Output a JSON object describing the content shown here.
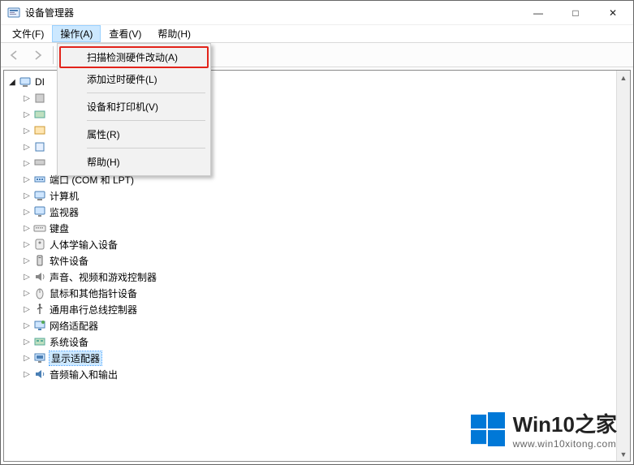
{
  "window": {
    "title": "设备管理器"
  },
  "menubar": {
    "items": [
      {
        "label": "文件(F)"
      },
      {
        "label": "操作(A)",
        "active": true
      },
      {
        "label": "查看(V)"
      },
      {
        "label": "帮助(H)"
      }
    ]
  },
  "dropdown": {
    "items": [
      {
        "label": "扫描检测硬件改动(A)",
        "highlight": true
      },
      {
        "label": "添加过时硬件(L)"
      },
      {
        "sep": true
      },
      {
        "label": "设备和打印机(V)"
      },
      {
        "sep": true
      },
      {
        "label": "属性(R)"
      },
      {
        "sep": true
      },
      {
        "label": "帮助(H)"
      }
    ]
  },
  "tree": {
    "root": {
      "label": "DI",
      "icon": "computer-icon",
      "expanded": true
    },
    "children": [
      {
        "label": "端口 (COM 和 LPT)",
        "icon": "port-icon"
      },
      {
        "label": "计算机",
        "icon": "computer-icon"
      },
      {
        "label": "监视器",
        "icon": "monitor-icon"
      },
      {
        "label": "键盘",
        "icon": "keyboard-icon"
      },
      {
        "label": "人体学输入设备",
        "icon": "hid-icon"
      },
      {
        "label": "软件设备",
        "icon": "software-icon"
      },
      {
        "label": "声音、视频和游戏控制器",
        "icon": "sound-icon"
      },
      {
        "label": "鼠标和其他指针设备",
        "icon": "mouse-icon"
      },
      {
        "label": "通用串行总线控制器",
        "icon": "usb-icon"
      },
      {
        "label": "网络适配器",
        "icon": "network-icon"
      },
      {
        "label": "系统设备",
        "icon": "system-icon"
      },
      {
        "label": "显示适配器",
        "icon": "display-icon",
        "selected": true
      },
      {
        "label": "音频输入和输出",
        "icon": "audio-icon"
      }
    ],
    "hidden_above_count": 5
  },
  "watermark": {
    "brand": "Win10",
    "suffix": "之家",
    "url": "www.win10xitong.com"
  }
}
